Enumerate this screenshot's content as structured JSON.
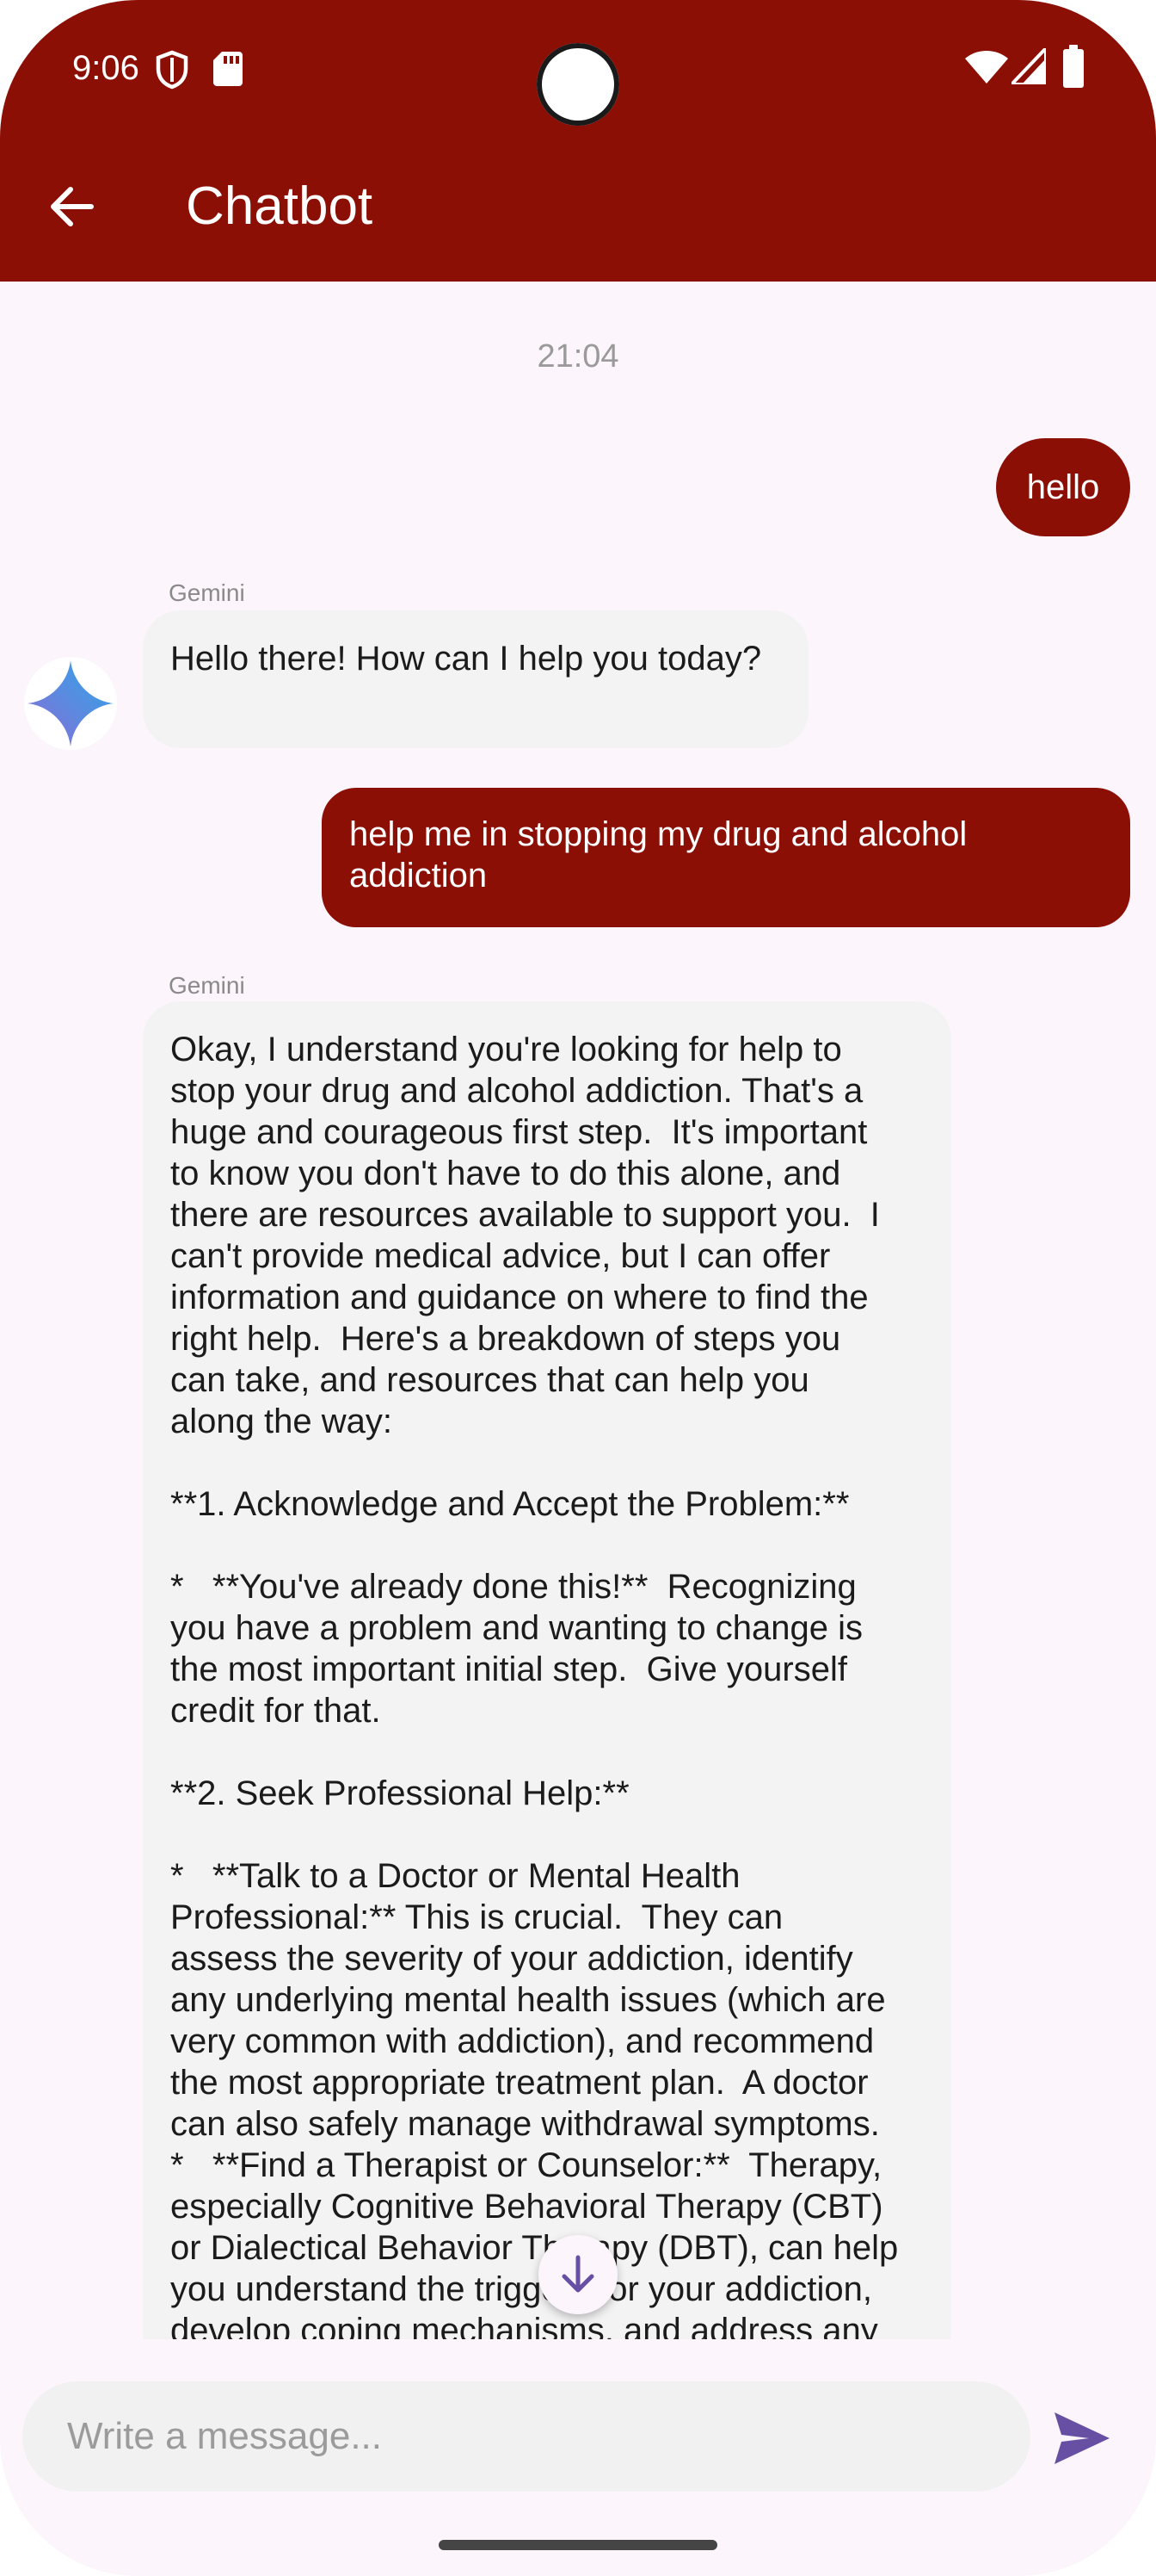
{
  "status_bar": {
    "time": "9:06",
    "icons": [
      "shield-icon",
      "sd-card-icon",
      "wifi-icon",
      "signal-icon",
      "battery-icon"
    ]
  },
  "app_bar": {
    "title": "Chatbot",
    "back_icon": "arrow-back-icon"
  },
  "chat": {
    "timestamp": "21:04",
    "messages": [
      {
        "role": "user",
        "text": "hello"
      },
      {
        "role": "bot",
        "sender": "Gemini",
        "text": "Hello there! How can I help you today?"
      },
      {
        "role": "user",
        "text": "help me in stopping my drug and alcohol\naddiction"
      },
      {
        "role": "bot",
        "sender": "Gemini",
        "text": "Okay, I understand you're looking for help to\nstop your drug and alcohol addiction. That's a\nhuge and courageous first step.  It's important\nto know you don't have to do this alone, and\nthere are resources available to support you.  I\ncan't provide medical advice, but I can offer\ninformation and guidance on where to find the\nright help.  Here's a breakdown of steps you\ncan take, and resources that can help you\nalong the way:\n\n**1. Acknowledge and Accept the Problem:**\n\n*   **You've already done this!**  Recognizing\nyou have a problem and wanting to change is\nthe most important initial step.  Give yourself\ncredit for that.\n\n**2. Seek Professional Help:**\n\n*   **Talk to a Doctor or Mental Health\nProfessional:** This is crucial.  They can\nassess the severity of your addiction, identify\nany underlying mental health issues (which are\nvery common with addiction), and recommend\nthe most appropriate treatment plan.  A doctor\ncan also safely manage withdrawal symptoms.\n*   **Find a Therapist or Counselor:**  Therapy,\nespecially Cognitive Behavioral Therapy (CBT)\nor Dialectical Behavior Therapy (DBT), can help\nyou understand the triggers for your addiction,\ndevelop coping mechanisms, and address any"
      }
    ]
  },
  "composer": {
    "placeholder": "Write a message...",
    "value": "",
    "send_icon": "send-icon"
  },
  "scroll_button": {
    "icon": "arrow-down-icon"
  },
  "colors": {
    "primary": "#8c0f05",
    "background": "#fcf5fb",
    "bot_bubble": "#f3f3f3",
    "send_accent": "#6750a4"
  }
}
